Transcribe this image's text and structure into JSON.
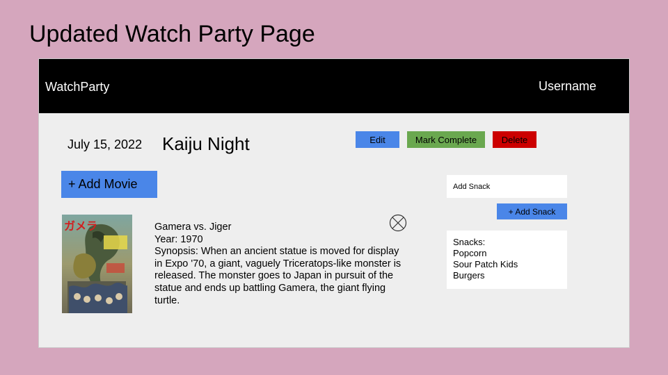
{
  "slide": {
    "title": "Updated Watch Party Page"
  },
  "navbar": {
    "brand": "WatchParty",
    "username": "Username"
  },
  "event": {
    "date": "July 15, 2022",
    "name": "Kaiju Night"
  },
  "actions": {
    "edit": "Edit",
    "mark_complete": "Mark Complete",
    "delete": "Delete"
  },
  "movies": {
    "add_label": "+ Add Movie",
    "items": [
      {
        "title": "Gamera vs. Jiger",
        "year": "Year: 1970",
        "synopsis": "Synopsis: When an ancient statue is moved for display in Expo '70, a giant, vaguely Triceratops-like monster is released. The monster goes to Japan in pursuit of the statue and ends up battling Gamera, the giant flying turtle.",
        "poster_text": "ガメラ"
      }
    ]
  },
  "snacks": {
    "input_placeholder": "Add Snack",
    "add_label": "+ Add Snack",
    "header": "Snacks:",
    "items": [
      "Popcorn",
      "Sour Patch Kids",
      "Burgers"
    ]
  },
  "colors": {
    "background": "#d5a6bd",
    "navbar": "#000000",
    "edit": "#4a86e8",
    "mark_complete": "#6aa84f",
    "delete": "#cc0000"
  }
}
